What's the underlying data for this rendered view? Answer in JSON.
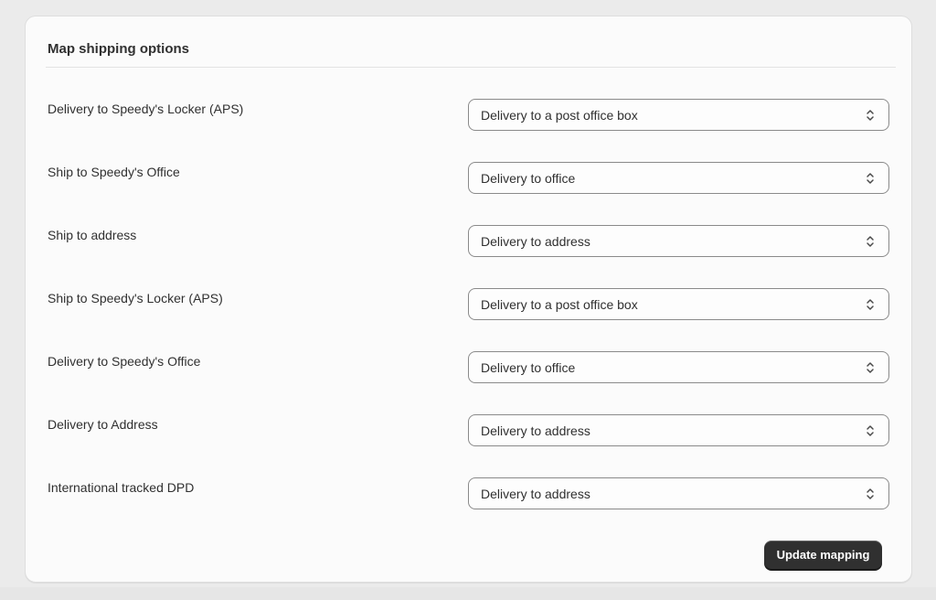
{
  "card": {
    "title": "Map shipping options"
  },
  "mappings": [
    {
      "label": "Delivery to Speedy's Locker (APS)",
      "selected": "Delivery to a post office box"
    },
    {
      "label": "Ship to Speedy's Office",
      "selected": "Delivery to office"
    },
    {
      "label": "Ship to address",
      "selected": "Delivery to address"
    },
    {
      "label": "Ship to Speedy's Locker (APS)",
      "selected": "Delivery to a post office box"
    },
    {
      "label": "Delivery to Speedy's Office",
      "selected": "Delivery to office"
    },
    {
      "label": "Delivery to Address",
      "selected": "Delivery to address"
    },
    {
      "label": "International tracked DPD",
      "selected": "Delivery to address"
    }
  ],
  "actions": {
    "update_label": "Update mapping"
  },
  "icons": {
    "select_indicator": "select-chevrons-icon"
  },
  "colors": {
    "primary_button": "#303030",
    "card_background": "#fbfbfb",
    "page_background": "#ebebeb"
  }
}
